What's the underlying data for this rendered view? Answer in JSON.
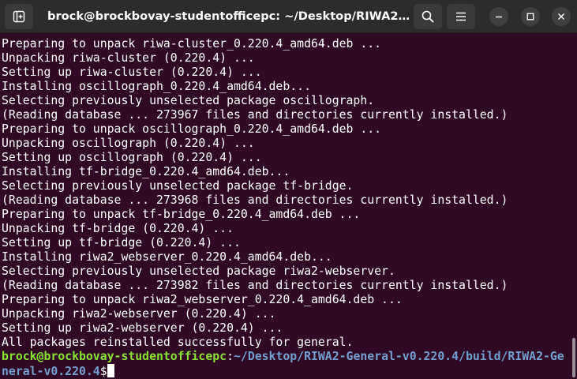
{
  "window": {
    "title": "brock@brockbovay-studentofficepc: ~/Desktop/RIWA2-Gene...",
    "icons": {
      "new_tab": "new-tab-icon",
      "search": "search-icon",
      "menu": "hamburger-menu-icon",
      "minimize": "minimize-icon",
      "maximize": "maximize-icon",
      "close": "close-icon"
    }
  },
  "colors": {
    "terminal_background": "#300a24",
    "prompt_user": "#8ae234",
    "prompt_path": "#729fcf",
    "text": "#ffffff"
  },
  "terminal": {
    "lines": [
      "Preparing to unpack riwa-cluster_0.220.4_amd64.deb ...",
      "Unpacking riwa-cluster (0.220.4) ...",
      "Setting up riwa-cluster (0.220.4) ...",
      "Installing oscillograph_0.220.4_amd64.deb...",
      "Selecting previously unselected package oscillograph.",
      "(Reading database ... 273967 files and directories currently installed.)",
      "Preparing to unpack oscillograph_0.220.4_amd64.deb ...",
      "Unpacking oscillograph (0.220.4) ...",
      "Setting up oscillograph (0.220.4) ...",
      "Installing tf-bridge_0.220.4_amd64.deb...",
      "Selecting previously unselected package tf-bridge.",
      "(Reading database ... 273968 files and directories currently installed.)",
      "Preparing to unpack tf-bridge_0.220.4_amd64.deb ...",
      "Unpacking tf-bridge (0.220.4) ...",
      "Setting up tf-bridge (0.220.4) ...",
      "Installing riwa2_webserver_0.220.4_amd64.deb...",
      "Selecting previously unselected package riwa2-webserver.",
      "(Reading database ... 273982 files and directories currently installed.)",
      "Preparing to unpack riwa2_webserver_0.220.4_amd64.deb ...",
      "Unpacking riwa2-webserver (0.220.4) ...",
      "Setting up riwa2-webserver (0.220.4) ...",
      "All packages reinstalled successfully for general."
    ],
    "prompt": {
      "user_host": "brock@brockbovay-studentofficepc",
      "separator": ":",
      "path_line1": "~/Desktop/RIWA2-General-v0.220.4/build/RIWA2-Ge",
      "path_line2": "neral-v0.220.4",
      "dollar": "$"
    }
  }
}
